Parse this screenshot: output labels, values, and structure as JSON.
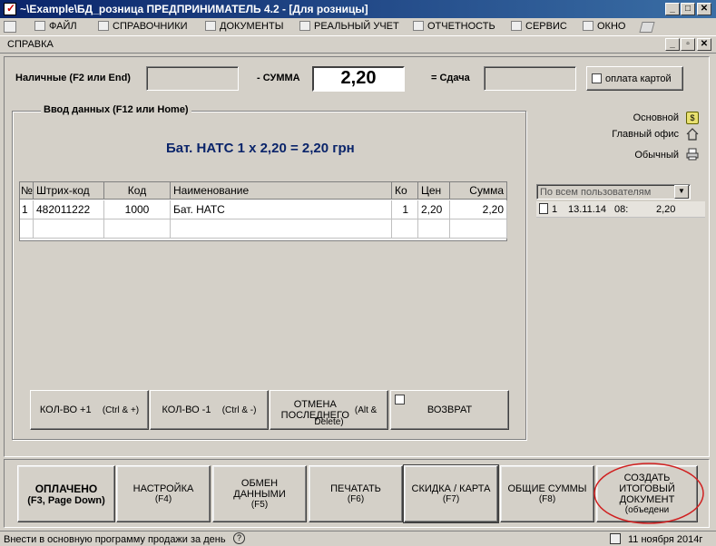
{
  "window": {
    "title": "~\\Example\\БД_розница  ПРЕДПРИНИМАТЕЛЬ 4.2 - [Для розницы]"
  },
  "menu": [
    "ФАЙЛ",
    "СПРАВОЧНИКИ",
    "ДОКУМЕНТЫ",
    "РЕАЛЬНЫЙ УЧЕТ",
    "ОТЧЕТНОСТЬ",
    "СЕРВИС",
    "ОКНО"
  ],
  "child_menu": "СПРАВКА",
  "payment": {
    "cash_label": "Наличные (F2 или End)",
    "sum_label": "- СУММА",
    "sum_value": "2,20",
    "change_label": "= Сдача",
    "card_label": "оплата картой"
  },
  "entry": {
    "group_label": "Ввод данных (F12 или Home)",
    "summary_line": "Бат. НАТС   1 х 2,20 = 2,20 грн"
  },
  "grid": {
    "headers": [
      "№",
      "Штрих-код",
      "Код",
      "Наименование",
      "Ко",
      "Цен",
      "Сумма"
    ],
    "rows": [
      [
        "1",
        "482011222",
        "1000",
        "Бат. НАТС",
        "1",
        "2,20",
        "2,20"
      ]
    ]
  },
  "action_buttons": {
    "qty_plus": "КОЛ-ВО +1",
    "qty_plus_hk": "(Ctrl & +)",
    "qty_minus": "КОЛ-ВО -1",
    "qty_minus_hk": "(Ctrl & -)",
    "cancel_last_1": "ОТМЕНА",
    "cancel_last_2": "ПОСЛЕДНЕГО",
    "cancel_last_hk": "(Alt &",
    "cancel_last_hk2": "Delete)",
    "return": "ВОЗВРАТ"
  },
  "right_panel": {
    "price_types": [
      "Основной",
      "Главный офис",
      "Обычный"
    ],
    "user_filter": "По всем пользователям",
    "receipt": {
      "no": "1",
      "date": "13.11.14",
      "time": "08:",
      "sum": "2,20"
    }
  },
  "bottom_buttons": [
    {
      "label": "ОПЛАЧЕНО",
      "hk": "(F3, Page Down)"
    },
    {
      "label": "НАСТРОЙКА",
      "hk": "(F4)"
    },
    {
      "label": "ОБМЕН ДАННЫМИ",
      "hk": "(F5)"
    },
    {
      "label": "ПЕЧАТАТЬ",
      "hk": "(F6)"
    },
    {
      "label": "СКИДКА / КАРТА",
      "hk": "(F7)"
    },
    {
      "label": "ОБЩИЕ СУММЫ",
      "hk": "(F8)"
    },
    {
      "label": "СОЗДАТЬ ИТОГОВЫЙ ДОКУМЕНТ",
      "hk": "(объедени"
    }
  ],
  "status": {
    "left": "Внести в основную программу продажи за день",
    "right": "11 ноября 2014г"
  },
  "colors": {
    "title_bar": "#0a246a",
    "summary_text": "#0a246a",
    "highlight_circle": "#d02020"
  }
}
